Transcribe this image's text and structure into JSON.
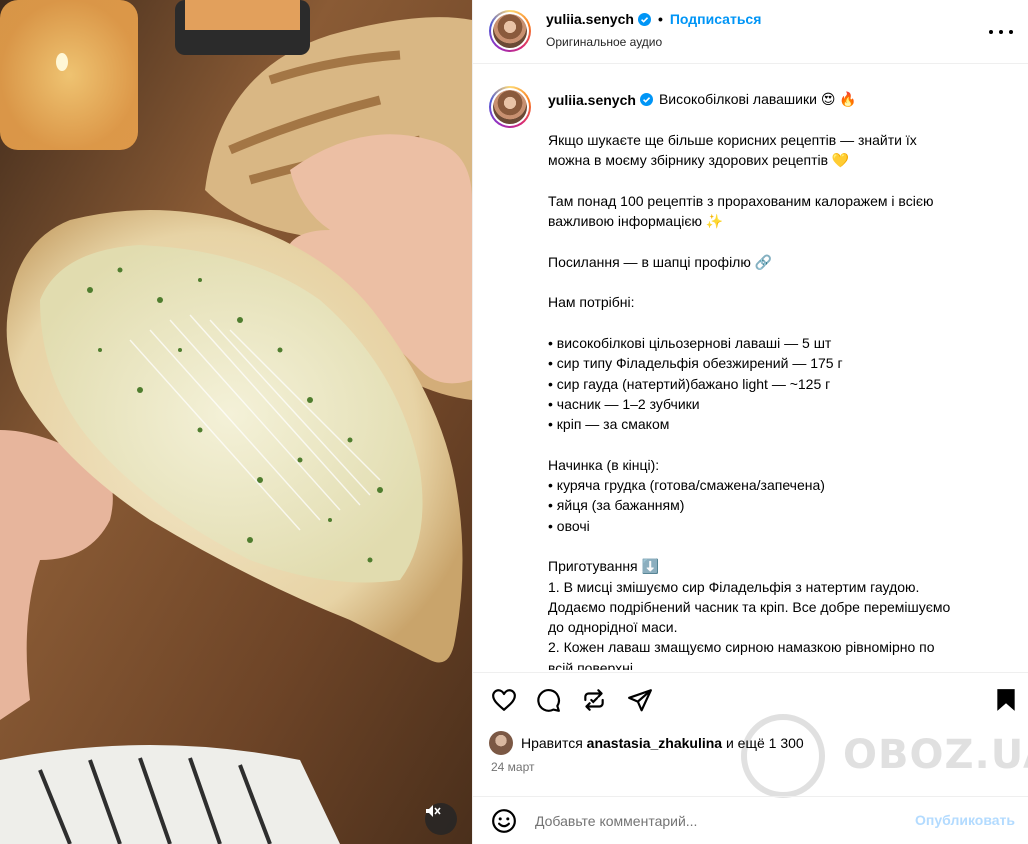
{
  "media": {
    "alt_icons": {
      "mute": "speaker-muted-icon"
    }
  },
  "header": {
    "username": "yuliia.senych",
    "separator": "•",
    "follow_label": "Подписаться",
    "audio_label": "Оригинальное аудио",
    "icons": {
      "verified": "verified-badge-icon",
      "more": "more-options-icon"
    }
  },
  "caption": {
    "username": "yuliia.senych",
    "title": "Високобілкові лавашики 😍 🔥",
    "lines": [
      "Якщо шукаєте ще більше корисних рецептів — знайти їх",
      "можна в моєму збірнику здорових рецептів 💛",
      "",
      "Там понад 100 рецептів з прорахованим калоражем і всією",
      "важливою інформацією ✨",
      "",
      "Посилання — в шапці профілю 🔗",
      "",
      "Нам потрібні:",
      "",
      "• високобілкові цільозернові лаваші — 5 шт",
      "• сир типу Філадельфія обезжирений — 175 г",
      "• сир гауда (натертий)бажано light — ~125 г",
      "• часник — 1–2 зубчики",
      "• кріп — за смаком",
      "",
      "Начинка (в кінці):",
      "• куряча грудка (готова/смажена/запечена)",
      "• яйця (за бажанням)",
      "• овочі",
      "",
      "Приготування ⬇️",
      "1. В мисці змішуємо сир Філадельфія з натертим гаудою.",
      "Додаємо подрібнений часник та кріп. Все добре перемішуємо",
      "до однорідної маси.",
      "2. Кожен лаваш змащуємо сирною намазкою рівномірно по",
      "всій поверхні."
    ]
  },
  "actions": {
    "icons": [
      "like-heart-icon",
      "comment-bubble-icon",
      "repost-icon",
      "share-send-icon",
      "save-bookmark-icon"
    ]
  },
  "likes": {
    "prefix": "Нравится",
    "user": "anastasia_zhakulina",
    "suffix": "и ещё 1 300"
  },
  "date": "24 март",
  "watermark": {
    "text": "OBOZ.UA"
  },
  "comment": {
    "placeholder": "Добавьте комментарий...",
    "value": "",
    "publish_label": "Опубликовать",
    "publish_color": "#b3dbff"
  },
  "colors": {
    "accent": "#0095f6",
    "muted": "#737373",
    "verified": "#0095f6"
  }
}
